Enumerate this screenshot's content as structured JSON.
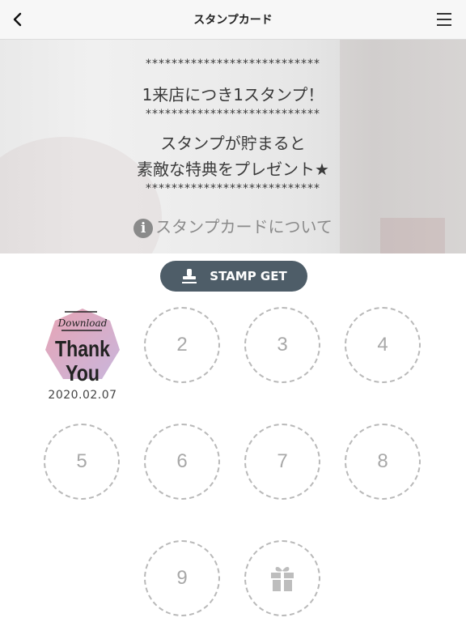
{
  "header": {
    "title": "スタンプカード"
  },
  "hero": {
    "stars1": "***************************",
    "line1": "1来店につき1スタンプ！",
    "stars2": "***************************",
    "line2": "スタンプが貯まると",
    "line3": "素敵な特典をプレゼント★",
    "stars3": "***************************",
    "info_link": "スタンプカードについて"
  },
  "stamp_button": {
    "label": "STAMP GET"
  },
  "stamp_card": {
    "stamped": {
      "top": "Download",
      "line1": "Thank",
      "line2": "You",
      "date": "2020.02.07"
    },
    "slots": [
      "2",
      "3",
      "4",
      "5",
      "6",
      "7",
      "8",
      "9"
    ],
    "reward_icon": "gift-icon"
  },
  "colors": {
    "button": "#4e5d68",
    "slot_border": "#b9b9b9",
    "stamp_pink": "#e7a4b4",
    "stamp_lilac": "#c9b6dc"
  }
}
